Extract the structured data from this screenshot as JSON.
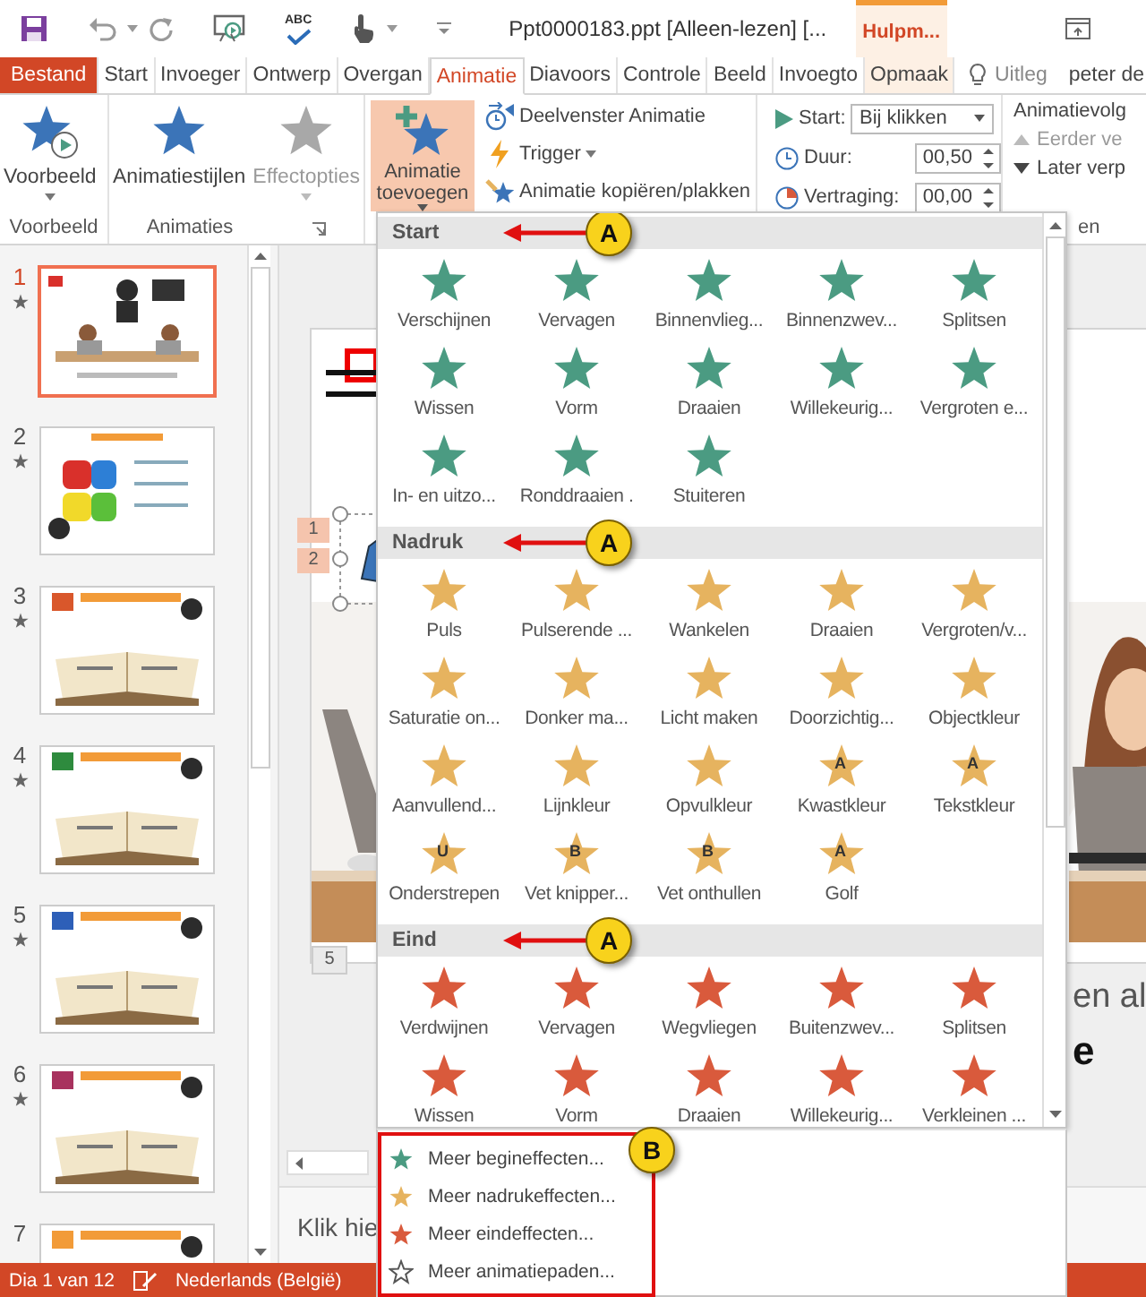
{
  "title_bar": {
    "spelling": "ABC",
    "title": "Ppt0000183.ppt [Alleen-lezen] [...",
    "context_tab": "Hulpm..."
  },
  "tabs": [
    {
      "label": "Bestand",
      "kind": "file",
      "selected": false
    },
    {
      "label": "Start",
      "kind": "tab",
      "selected": false
    },
    {
      "label": "Invoeger",
      "kind": "tab",
      "selected": false
    },
    {
      "label": "Ontwerp",
      "kind": "tab",
      "selected": false
    },
    {
      "label": "Overgan",
      "kind": "tab",
      "selected": false
    },
    {
      "label": "Animatie",
      "kind": "tab",
      "selected": true
    },
    {
      "label": "Diavoors",
      "kind": "tab",
      "selected": false
    },
    {
      "label": "Controle",
      "kind": "tab",
      "selected": false
    },
    {
      "label": "Beeld",
      "kind": "tab",
      "selected": false
    },
    {
      "label": "Invoegto",
      "kind": "tab",
      "selected": false
    },
    {
      "label": "Opmaak",
      "kind": "context",
      "selected": false
    }
  ],
  "tell_me": "Uitleg",
  "user": "peter de",
  "ribbon": {
    "preview": {
      "label": "Voorbeeld",
      "group": "Voorbeeld"
    },
    "animations": {
      "styles": {
        "label": "Animatiestijlen",
        "disabled": false
      },
      "options": {
        "label": "Effectopties",
        "disabled": true
      },
      "group": "Animaties"
    },
    "add": {
      "label": "Animatie toevoegen",
      "selected": true
    },
    "advanced": [
      {
        "label": "Deelvenster Animatie",
        "kind": "pane",
        "menu": false
      },
      {
        "label": "Trigger",
        "kind": "trigger",
        "menu": true
      },
      {
        "label": "Animatie kopiëren/plakken",
        "kind": "painter",
        "menu": false
      }
    ],
    "timing": {
      "start_label": "Start:",
      "start_value": "Bij klikken",
      "duration_label": "Duur:",
      "duration_value": "00,50",
      "delay_label": "Vertraging:",
      "delay_value": "00,00",
      "group": "en"
    },
    "reorder": {
      "title": "Animatievolg",
      "items": [
        {
          "label": "Eerder ve",
          "kind": "up",
          "disabled": true
        },
        {
          "label": "Later verp",
          "kind": "down",
          "disabled": false
        }
      ]
    }
  },
  "slides": [
    {
      "number": "1",
      "selected": true,
      "animated": true
    },
    {
      "number": "2",
      "selected": false,
      "animated": true
    },
    {
      "number": "3",
      "selected": false,
      "animated": true
    },
    {
      "number": "4",
      "selected": false,
      "animated": true
    },
    {
      "number": "5",
      "selected": false,
      "animated": true
    },
    {
      "number": "6",
      "selected": false,
      "animated": true
    },
    {
      "number": "7",
      "selected": false,
      "animated": false
    }
  ],
  "slide": {
    "tags": [
      "1",
      "2"
    ],
    "bottom_tag": "5",
    "title_fragment": "en al",
    "subtitle_fragment": "e",
    "notes": "Klik hie"
  },
  "gallery": {
    "sections": [
      {
        "title": "Start",
        "kind": "entrance",
        "callout": "A",
        "effects": [
          {
            "label": "Verschijnen"
          },
          {
            "label": "Vervagen"
          },
          {
            "label": "Binnenvlieg..."
          },
          {
            "label": "Binnenzwev..."
          },
          {
            "label": "Splitsen"
          },
          {
            "label": "Wissen"
          },
          {
            "label": "Vorm"
          },
          {
            "label": "Draaien"
          },
          {
            "label": "Willekeurig..."
          },
          {
            "label": "Vergroten e..."
          },
          {
            "label": "In- en uitzo..."
          },
          {
            "label": "Ronddraaien ."
          },
          {
            "label": "Stuiteren"
          }
        ]
      },
      {
        "title": "Nadruk",
        "kind": "emphasis",
        "callout": "A",
        "effects": [
          {
            "label": "Puls"
          },
          {
            "label": "Pulserende ..."
          },
          {
            "label": "Wankelen"
          },
          {
            "label": "Draaien"
          },
          {
            "label": "Vergroten/v..."
          },
          {
            "label": "Saturatie on..."
          },
          {
            "label": "Donker ma..."
          },
          {
            "label": "Licht maken"
          },
          {
            "label": "Doorzichtig..."
          },
          {
            "label": "Objectkleur"
          },
          {
            "label": "Aanvullend..."
          },
          {
            "label": "Lijnkleur"
          },
          {
            "label": "Opvulkleur"
          },
          {
            "label": "Kwastkleur",
            "glyph": "A"
          },
          {
            "label": "Tekstkleur",
            "glyph": "A"
          },
          {
            "label": "Onderstrepen",
            "glyph": "U"
          },
          {
            "label": "Vet knipper...",
            "glyph": "B"
          },
          {
            "label": "Vet onthullen",
            "glyph": "B"
          },
          {
            "label": "Golf",
            "glyph": "A"
          }
        ]
      },
      {
        "title": "Eind",
        "kind": "exit",
        "callout": "A",
        "effects": [
          {
            "label": "Verdwijnen"
          },
          {
            "label": "Vervagen"
          },
          {
            "label": "Wegvliegen"
          },
          {
            "label": "Buitenzwev..."
          },
          {
            "label": "Splitsen"
          },
          {
            "label": "Wissen"
          },
          {
            "label": "Vorm"
          },
          {
            "label": "Draaien"
          },
          {
            "label": "Willekeurig..."
          },
          {
            "label": "Verkleinen ..."
          }
        ]
      }
    ]
  },
  "more_menu": {
    "callout": "B",
    "items": [
      {
        "label": "Meer begineffecten...",
        "kind": "entrance"
      },
      {
        "label": "Meer nadrukeffecten...",
        "kind": "emphasis"
      },
      {
        "label": "Meer eindeffecten...",
        "kind": "exit"
      },
      {
        "label": "Meer animatiepaden...",
        "kind": "path"
      }
    ]
  },
  "status_bar": {
    "slide": "Dia 1 van 12",
    "language": "Nederlands (België)"
  }
}
